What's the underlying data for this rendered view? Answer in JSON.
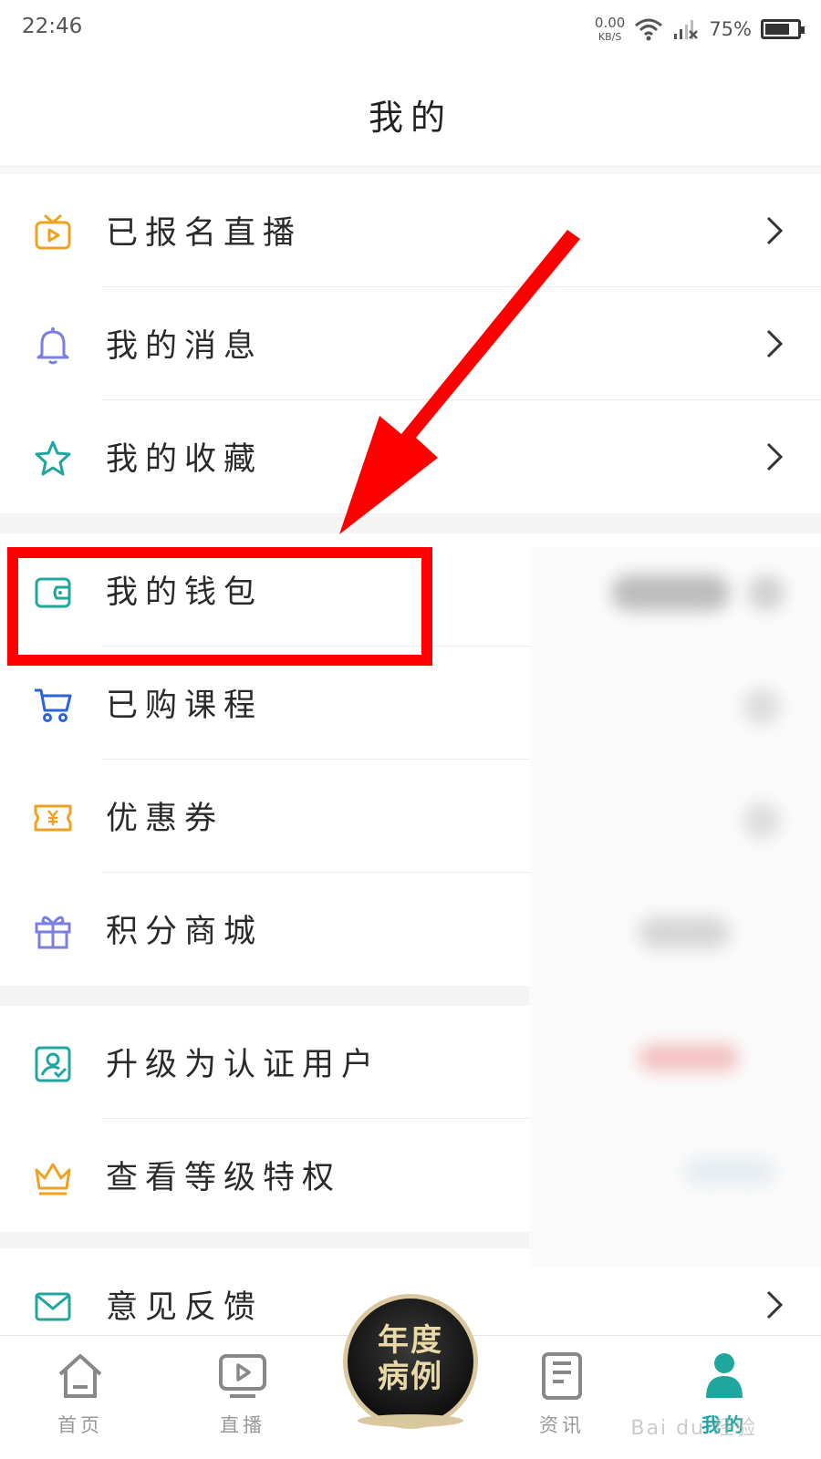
{
  "status_bar": {
    "time": "22:46",
    "net_speed": "0.00",
    "net_unit": "KB/S",
    "battery_percent": "75%",
    "battery_level": 0.75
  },
  "header": {
    "title": "我的"
  },
  "menu": {
    "live": "已报名直播",
    "messages": "我的消息",
    "favorites": "我的收藏",
    "wallet": "我的钱包",
    "courses": "已购课程",
    "coupons": "优惠券",
    "points_mall": "积分商城",
    "certify": "升级为认证用户",
    "privileges": "查看等级特权",
    "feedback": "意见反馈"
  },
  "tabbar": {
    "home": "首页",
    "live": "直播",
    "center_line1": "年度",
    "center_line2": "病例",
    "news": "资讯",
    "mine": "我的"
  },
  "colors": {
    "accent": "#1fa69e",
    "highlight": "#ff0000",
    "orange": "#f0a21e",
    "purple": "#7b7fe0",
    "blue": "#2b63d9"
  },
  "watermark": "Bai du 经验"
}
